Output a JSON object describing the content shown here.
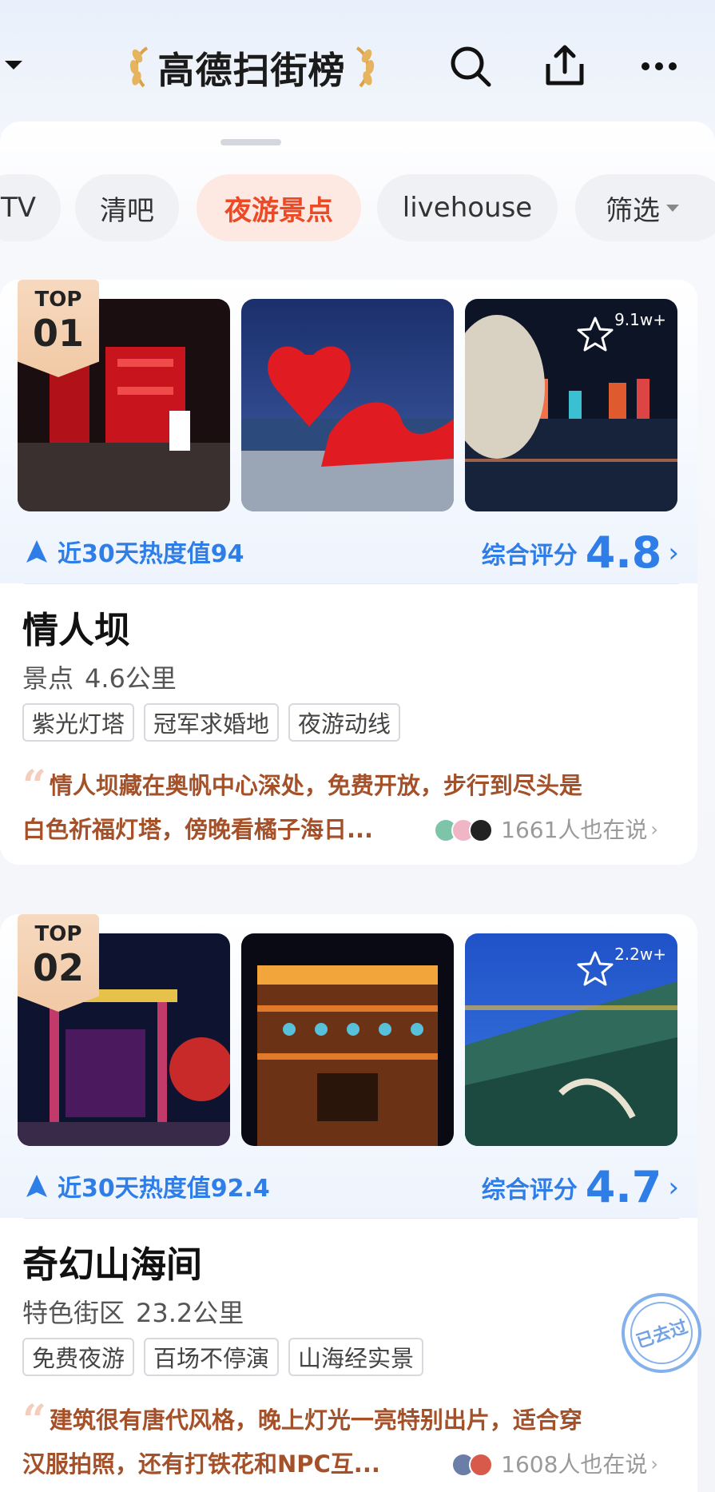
{
  "header": {
    "title": "高德扫街榜",
    "icons": [
      "dropdown-chevron-icon",
      "laurel-icon",
      "search-icon",
      "share-icon",
      "more-icon"
    ]
  },
  "filters": {
    "chips": [
      "TV",
      "清吧",
      "夜游景点",
      "livehouse",
      "筛选"
    ],
    "active": "夜游景点"
  },
  "cards": [
    {
      "rank_top": "TOP",
      "rank_num": "01",
      "favorites": "9.1w+",
      "heat_label": "近30天热度值94",
      "score_label": "综合评分",
      "score": "4.8",
      "name": "情人坝",
      "category": "景点",
      "distance": "4.6公里",
      "tags": [
        "紫光灯塔",
        "冠军求婚地",
        "夜游动线"
      ],
      "quote_line1": "情人坝藏在奥帆中心深处，免费开放，步行到尽头是",
      "quote_line2": "白色祈福灯塔，傍晚看橘子海日...",
      "talk": "1661人也在说"
    },
    {
      "rank_top": "TOP",
      "rank_num": "02",
      "favorites": "2.2w+",
      "heat_label": "近30天热度值92.4",
      "score_label": "综合评分",
      "score": "4.7",
      "name": "奇幻山海间",
      "category": "特色街区",
      "distance": "23.2公里",
      "tags": [
        "免费夜游",
        "百场不停演",
        "山海经实景"
      ],
      "quote_line1": "建筑很有唐代风格，晚上灯光一亮特别出片，适合穿",
      "quote_line2": "汉服拍照，还有打铁花和NPC互...",
      "talk": "1608人也在说"
    }
  ],
  "stamp": {
    "text": "已去过"
  },
  "colors": {
    "accent_blue": "#2f7ee8",
    "active_chip": "#ec4a26",
    "quote": "#a4512a"
  }
}
